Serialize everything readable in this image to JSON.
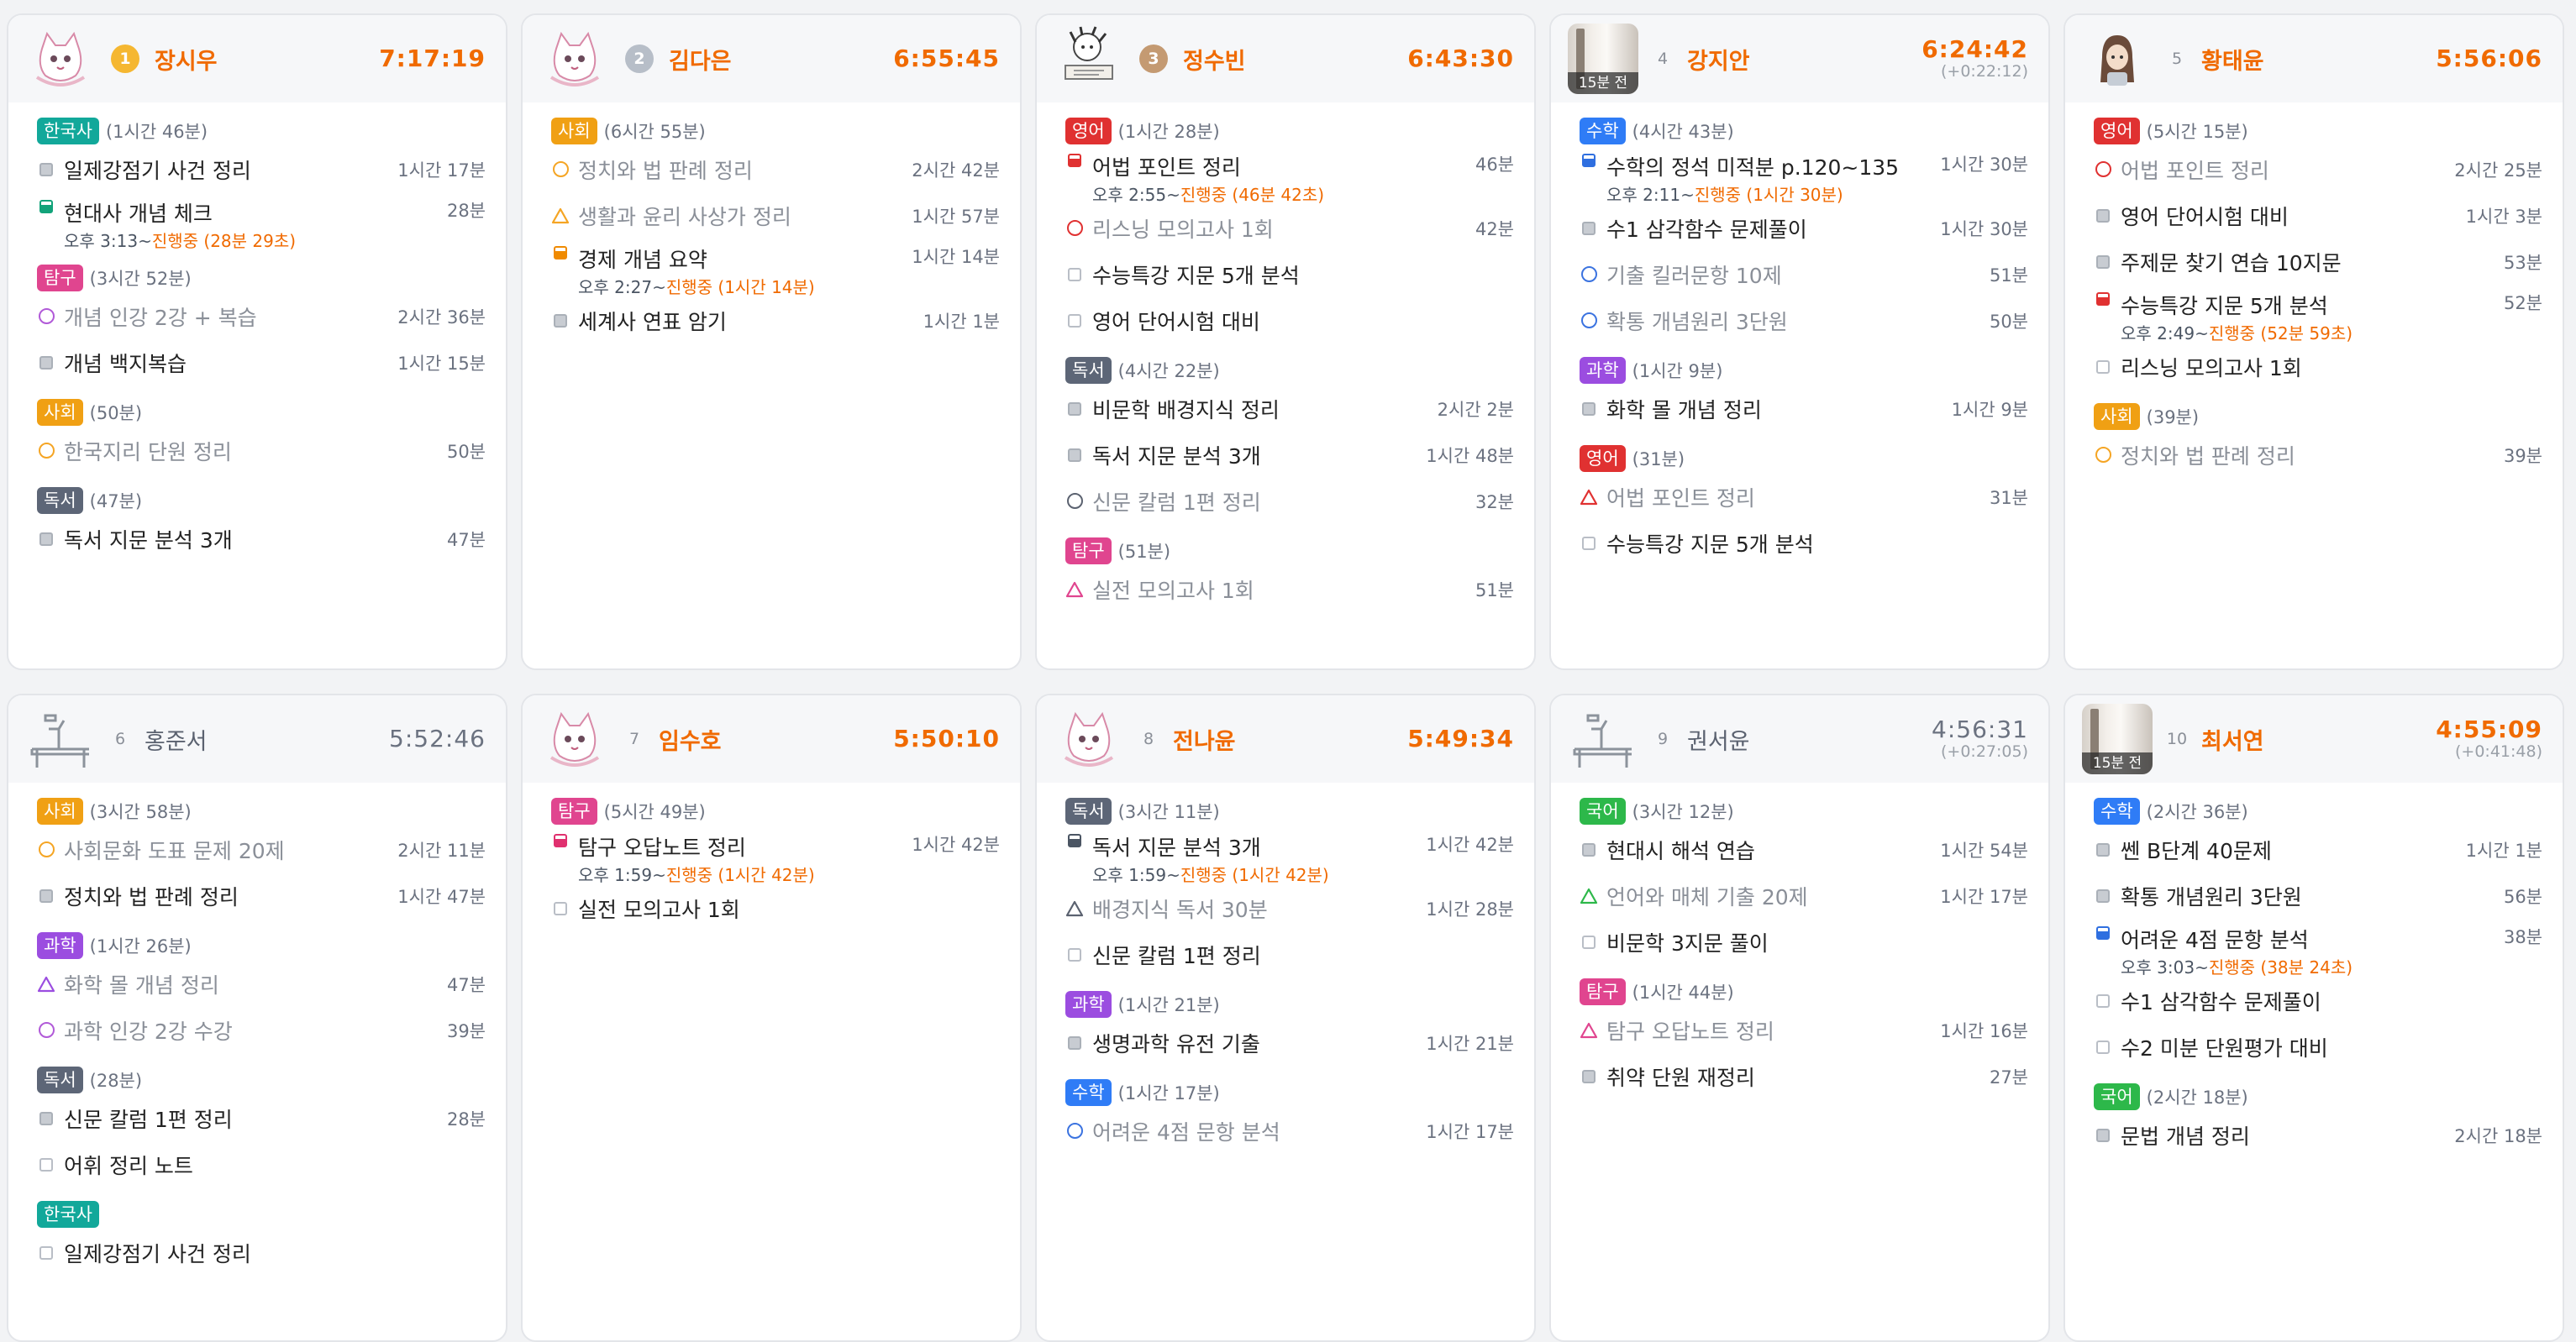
{
  "tag_colors": {
    "한국사": "#12a89a",
    "탐구": "#e0458f",
    "사회": "#f0a014",
    "독서": "#5d6677",
    "영어": "#e03131",
    "수학": "#2f7cf6",
    "과학": "#9b4de0",
    "국어": "#2db84a"
  },
  "status_colors": {
    "circle-orange": "#f5a524",
    "circle-purple": "#b15ad8",
    "circle-dark": "#5b6270",
    "circle-blue": "#3b73e0",
    "circle-red": "#e03131",
    "triangle-orange": "#f5a524",
    "triangle-pink": "#e0458f",
    "triangle-purple": "#9b4de0",
    "triangle-red": "#e03131",
    "triangle-green": "#2db84a",
    "triangle-dark": "#5b6270"
  },
  "students": [
    {
      "rank": "1",
      "rank_style": "r1",
      "name": "장시우",
      "time": "7:17:19",
      "time_extra": "",
      "active": true,
      "avatar": "cat",
      "avatar_badge": "",
      "categories": [
        {
          "tag": "한국사",
          "duration": "(1시간 46분)",
          "tasks": [
            {
              "text": "일제강점기 사건 정리",
              "duration": "1시간 17분",
              "status": "sq-full",
              "dim": false,
              "sub_time": "",
              "sub_run": ""
            },
            {
              "text": "현대사 개념 체크",
              "duration": "28분",
              "status": "sq-green",
              "dim": false,
              "sub_time": "오후 3:13~",
              "sub_run": "진행중 (28분 29초)"
            }
          ]
        },
        {
          "tag": "탐구",
          "duration": "(3시간 52분)",
          "tasks": [
            {
              "text": "개념 인강 2강 + 복습",
              "duration": "2시간 36분",
              "status": "circle-purple",
              "dim": true,
              "sub_time": "",
              "sub_run": ""
            },
            {
              "text": "개념 백지복습",
              "duration": "1시간 15분",
              "status": "sq-full",
              "dim": false,
              "sub_time": "",
              "sub_run": ""
            }
          ]
        },
        {
          "tag": "사회",
          "duration": "(50분)",
          "tasks": [
            {
              "text": "한국지리 단원 정리",
              "duration": "50분",
              "status": "circle-orange",
              "dim": true,
              "sub_time": "",
              "sub_run": ""
            }
          ]
        },
        {
          "tag": "독서",
          "duration": "(47분)",
          "tasks": [
            {
              "text": "독서 지문 분석 3개",
              "duration": "47분",
              "status": "sq-full",
              "dim": false,
              "sub_time": "",
              "sub_run": ""
            }
          ]
        }
      ]
    },
    {
      "rank": "2",
      "rank_style": "r2",
      "name": "김다은",
      "time": "6:55:45",
      "time_extra": "",
      "active": true,
      "avatar": "cat",
      "avatar_badge": "",
      "categories": [
        {
          "tag": "사회",
          "duration": "(6시간 55분)",
          "tasks": [
            {
              "text": "정치와 법 판례 정리",
              "duration": "2시간 42분",
              "status": "circle-orange",
              "dim": true,
              "sub_time": "",
              "sub_run": ""
            },
            {
              "text": "생활과 윤리 사상가 정리",
              "duration": "1시간 57분",
              "status": "triangle-orange",
              "dim": true,
              "sub_time": "",
              "sub_run": ""
            },
            {
              "text": "경제 개념 요약",
              "duration": "1시간 14분",
              "status": "sq-orange",
              "dim": false,
              "sub_time": "오후 2:27~",
              "sub_run": "진행중 (1시간 14분)"
            },
            {
              "text": "세계사 연표 암기",
              "duration": "1시간 1분",
              "status": "sq-full",
              "dim": false,
              "sub_time": "",
              "sub_run": ""
            }
          ]
        }
      ]
    },
    {
      "rank": "3",
      "rank_style": "r3",
      "name": "정수빈",
      "time": "6:43:30",
      "time_extra": "",
      "active": true,
      "avatar": "doodle",
      "avatar_badge": "",
      "categories": [
        {
          "tag": "영어",
          "duration": "(1시간 28분)",
          "tasks": [
            {
              "text": "어법 포인트 정리",
              "duration": "46분",
              "status": "sq-red",
              "dim": false,
              "sub_time": "오후 2:55~",
              "sub_run": "진행중 (46분 42초)"
            },
            {
              "text": "리스닝 모의고사 1회",
              "duration": "42분",
              "status": "circle-red",
              "dim": true,
              "sub_time": "",
              "sub_run": ""
            },
            {
              "text": "수능특강 지문 5개 분석",
              "duration": "",
              "status": "sq-empty",
              "dim": false,
              "sub_time": "",
              "sub_run": ""
            },
            {
              "text": "영어 단어시험 대비",
              "duration": "",
              "status": "sq-empty",
              "dim": false,
              "sub_time": "",
              "sub_run": ""
            }
          ]
        },
        {
          "tag": "독서",
          "duration": "(4시간 22분)",
          "tasks": [
            {
              "text": "비문학 배경지식 정리",
              "duration": "2시간 2분",
              "status": "sq-full",
              "dim": false,
              "sub_time": "",
              "sub_run": ""
            },
            {
              "text": "독서 지문 분석 3개",
              "duration": "1시간 48분",
              "status": "sq-full",
              "dim": false,
              "sub_time": "",
              "sub_run": ""
            },
            {
              "text": "신문 칼럼 1편 정리",
              "duration": "32분",
              "status": "circle-dark",
              "dim": true,
              "sub_time": "",
              "sub_run": ""
            }
          ]
        },
        {
          "tag": "탐구",
          "duration": "(51분)",
          "tasks": [
            {
              "text": "실전 모의고사 1회",
              "duration": "51분",
              "status": "triangle-pink",
              "dim": true,
              "sub_time": "",
              "sub_run": ""
            }
          ]
        }
      ]
    },
    {
      "rank": "4",
      "rank_style": "plain",
      "name": "강지안",
      "time": "6:24:42",
      "time_extra": "(+0:22:12)",
      "active": true,
      "avatar": "photo",
      "avatar_badge": "15분 전",
      "categories": [
        {
          "tag": "수학",
          "duration": "(4시간 43분)",
          "tasks": [
            {
              "text": "수학의 정석 미적분 p.120~135",
              "duration": "1시간 30분",
              "status": "sq-blue",
              "dim": false,
              "sub_time": "오후 2:11~",
              "sub_run": "진행중 (1시간 30분)"
            },
            {
              "text": "수1 삼각함수 문제풀이",
              "duration": "1시간 30분",
              "status": "sq-full",
              "dim": false,
              "sub_time": "",
              "sub_run": ""
            },
            {
              "text": "기출 킬러문항 10제",
              "duration": "51분",
              "status": "circle-blue",
              "dim": true,
              "sub_time": "",
              "sub_run": ""
            },
            {
              "text": "확통 개념원리 3단원",
              "duration": "50분",
              "status": "circle-blue",
              "dim": true,
              "sub_time": "",
              "sub_run": ""
            }
          ]
        },
        {
          "tag": "과학",
          "duration": "(1시간 9분)",
          "tasks": [
            {
              "text": "화학 몰 개념 정리",
              "duration": "1시간 9분",
              "status": "sq-full",
              "dim": false,
              "sub_time": "",
              "sub_run": ""
            }
          ]
        },
        {
          "tag": "영어",
          "duration": "(31분)",
          "tasks": [
            {
              "text": "어법 포인트 정리",
              "duration": "31분",
              "status": "triangle-red",
              "dim": true,
              "sub_time": "",
              "sub_run": ""
            },
            {
              "text": "수능특강 지문 5개 분석",
              "duration": "",
              "status": "sq-empty",
              "dim": false,
              "sub_time": "",
              "sub_run": ""
            }
          ]
        }
      ]
    },
    {
      "rank": "5",
      "rank_style": "plain",
      "name": "황태윤",
      "time": "5:56:06",
      "time_extra": "",
      "active": true,
      "avatar": "girl",
      "avatar_badge": "",
      "categories": [
        {
          "tag": "영어",
          "duration": "(5시간 15분)",
          "tasks": [
            {
              "text": "어법 포인트 정리",
              "duration": "2시간 25분",
              "status": "circle-red",
              "dim": true,
              "sub_time": "",
              "sub_run": ""
            },
            {
              "text": "영어 단어시험 대비",
              "duration": "1시간 3분",
              "status": "sq-full",
              "dim": false,
              "sub_time": "",
              "sub_run": ""
            },
            {
              "text": "주제문 찾기 연습 10지문",
              "duration": "53분",
              "status": "sq-full",
              "dim": false,
              "sub_time": "",
              "sub_run": ""
            },
            {
              "text": "수능특강 지문 5개 분석",
              "duration": "52분",
              "status": "sq-red",
              "dim": false,
              "sub_time": "오후 2:49~",
              "sub_run": "진행중 (52분 59초)"
            },
            {
              "text": "리스닝 모의고사 1회",
              "duration": "",
              "status": "sq-empty",
              "dim": false,
              "sub_time": "",
              "sub_run": ""
            }
          ]
        },
        {
          "tag": "사회",
          "duration": "(39분)",
          "tasks": [
            {
              "text": "정치와 법 판례 정리",
              "duration": "39분",
              "status": "circle-orange",
              "dim": true,
              "sub_time": "",
              "sub_run": ""
            }
          ]
        }
      ]
    },
    {
      "rank": "6",
      "rank_style": "plain",
      "name": "홍준서",
      "time": "5:52:46",
      "time_extra": "",
      "active": false,
      "avatar": "desk",
      "avatar_badge": "",
      "categories": [
        {
          "tag": "사회",
          "duration": "(3시간 58분)",
          "tasks": [
            {
              "text": "사회문화 도표 문제 20제",
              "duration": "2시간 11분",
              "status": "circle-orange",
              "dim": true,
              "sub_time": "",
              "sub_run": ""
            },
            {
              "text": "정치와 법 판례 정리",
              "duration": "1시간 47분",
              "status": "sq-full",
              "dim": false,
              "sub_time": "",
              "sub_run": ""
            }
          ]
        },
        {
          "tag": "과학",
          "duration": "(1시간 26분)",
          "tasks": [
            {
              "text": "화학 몰 개념 정리",
              "duration": "47분",
              "status": "triangle-purple",
              "dim": true,
              "sub_time": "",
              "sub_run": ""
            },
            {
              "text": "과학 인강 2강 수강",
              "duration": "39분",
              "status": "circle-purple",
              "dim": true,
              "sub_time": "",
              "sub_run": ""
            }
          ]
        },
        {
          "tag": "독서",
          "duration": "(28분)",
          "tasks": [
            {
              "text": "신문 칼럼 1편 정리",
              "duration": "28분",
              "status": "sq-full",
              "dim": false,
              "sub_time": "",
              "sub_run": ""
            },
            {
              "text": "어휘 정리 노트",
              "duration": "",
              "status": "sq-empty",
              "dim": false,
              "sub_time": "",
              "sub_run": ""
            }
          ]
        },
        {
          "tag": "한국사",
          "duration": "",
          "tasks": [
            {
              "text": "일제강점기 사건 정리",
              "duration": "",
              "status": "sq-empty",
              "dim": false,
              "sub_time": "",
              "sub_run": ""
            }
          ]
        }
      ]
    },
    {
      "rank": "7",
      "rank_style": "plain",
      "name": "임수호",
      "time": "5:50:10",
      "time_extra": "",
      "active": true,
      "avatar": "cat",
      "avatar_badge": "",
      "categories": [
        {
          "tag": "탐구",
          "duration": "(5시간 49분)",
          "tasks": [
            {
              "text": "탐구 오답노트 정리",
              "duration": "1시간 42분",
              "status": "sq-pink",
              "dim": false,
              "sub_time": "오후 1:59~",
              "sub_run": "진행중 (1시간 42분)"
            },
            {
              "text": "실전 모의고사 1회",
              "duration": "",
              "status": "sq-empty",
              "dim": false,
              "sub_time": "",
              "sub_run": ""
            }
          ]
        }
      ]
    },
    {
      "rank": "8",
      "rank_style": "plain",
      "name": "전나윤",
      "time": "5:49:34",
      "time_extra": "",
      "active": true,
      "avatar": "cat",
      "avatar_badge": "",
      "categories": [
        {
          "tag": "독서",
          "duration": "(3시간 11분)",
          "tasks": [
            {
              "text": "독서 지문 분석 3개",
              "duration": "1시간 42분",
              "status": "sq-dark",
              "dim": false,
              "sub_time": "오후 1:59~",
              "sub_run": "진행중 (1시간 42분)"
            },
            {
              "text": "배경지식 독서 30분",
              "duration": "1시간 28분",
              "status": "triangle-dark",
              "dim": true,
              "sub_time": "",
              "sub_run": ""
            },
            {
              "text": "신문 칼럼 1편 정리",
              "duration": "",
              "status": "sq-empty",
              "dim": false,
              "sub_time": "",
              "sub_run": ""
            }
          ]
        },
        {
          "tag": "과학",
          "duration": "(1시간 21분)",
          "tasks": [
            {
              "text": "생명과학 유전 기출",
              "duration": "1시간 21분",
              "status": "sq-full",
              "dim": false,
              "sub_time": "",
              "sub_run": ""
            }
          ]
        },
        {
          "tag": "수학",
          "duration": "(1시간 17분)",
          "tasks": [
            {
              "text": "어려운 4점 문항 분석",
              "duration": "1시간 17분",
              "status": "circle-blue",
              "dim": true,
              "sub_time": "",
              "sub_run": ""
            }
          ]
        }
      ]
    },
    {
      "rank": "9",
      "rank_style": "plain",
      "name": "권서윤",
      "time": "4:56:31",
      "time_extra": "(+0:27:05)",
      "active": false,
      "avatar": "desk",
      "avatar_badge": "",
      "categories": [
        {
          "tag": "국어",
          "duration": "(3시간 12분)",
          "tasks": [
            {
              "text": "현대시 해석 연습",
              "duration": "1시간 54분",
              "status": "sq-full",
              "dim": false,
              "sub_time": "",
              "sub_run": ""
            },
            {
              "text": "언어와 매체 기출 20제",
              "duration": "1시간 17분",
              "status": "triangle-green",
              "dim": true,
              "sub_time": "",
              "sub_run": ""
            },
            {
              "text": "비문학 3지문 풀이",
              "duration": "",
              "status": "sq-empty",
              "dim": false,
              "sub_time": "",
              "sub_run": ""
            }
          ]
        },
        {
          "tag": "탐구",
          "duration": "(1시간 44분)",
          "tasks": [
            {
              "text": "탐구 오답노트 정리",
              "duration": "1시간 16분",
              "status": "triangle-pink",
              "dim": true,
              "sub_time": "",
              "sub_run": ""
            },
            {
              "text": "취약 단원 재정리",
              "duration": "27분",
              "status": "sq-full",
              "dim": false,
              "sub_time": "",
              "sub_run": ""
            }
          ]
        }
      ]
    },
    {
      "rank": "10",
      "rank_style": "plain",
      "name": "최서연",
      "time": "4:55:09",
      "time_extra": "(+0:41:48)",
      "active": true,
      "avatar": "photo",
      "avatar_badge": "15분 전",
      "categories": [
        {
          "tag": "수학",
          "duration": "(2시간 36분)",
          "tasks": [
            {
              "text": "쎈 B단계 40문제",
              "duration": "1시간 1분",
              "status": "sq-full",
              "dim": false,
              "sub_time": "",
              "sub_run": ""
            },
            {
              "text": "확통 개념원리 3단원",
              "duration": "56분",
              "status": "sq-full",
              "dim": false,
              "sub_time": "",
              "sub_run": ""
            },
            {
              "text": "어려운 4점 문항 분석",
              "duration": "38분",
              "status": "sq-blue",
              "dim": false,
              "sub_time": "오후 3:03~",
              "sub_run": "진행중 (38분 24초)"
            },
            {
              "text": "수1 삼각함수 문제풀이",
              "duration": "",
              "status": "sq-empty",
              "dim": false,
              "sub_time": "",
              "sub_run": ""
            },
            {
              "text": "수2 미분 단원평가 대비",
              "duration": "",
              "status": "sq-empty",
              "dim": false,
              "sub_time": "",
              "sub_run": ""
            }
          ]
        },
        {
          "tag": "국어",
          "duration": "(2시간 18분)",
          "tasks": [
            {
              "text": "문법 개념 정리",
              "duration": "2시간 18분",
              "status": "sq-full",
              "dim": false,
              "sub_time": "",
              "sub_run": ""
            }
          ]
        }
      ]
    }
  ]
}
